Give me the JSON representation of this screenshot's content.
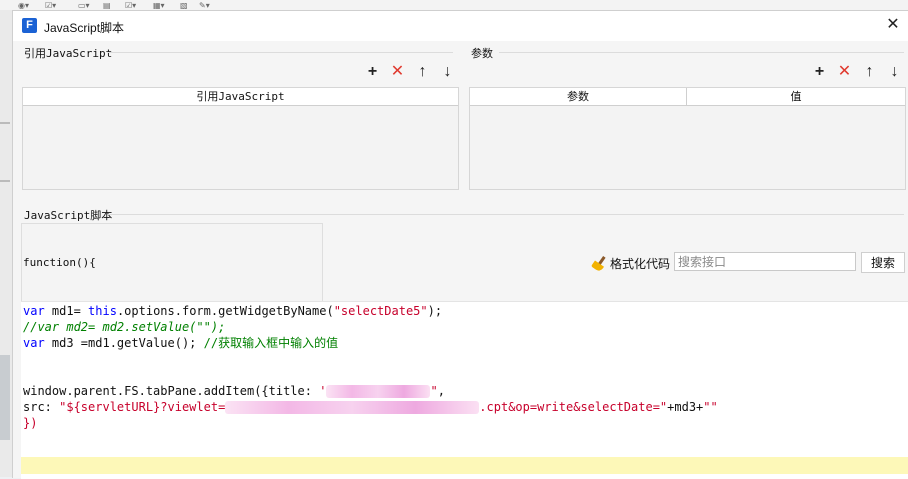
{
  "window": {
    "title": "JavaScript脚本",
    "logo_text": "F"
  },
  "left_panel": {
    "section_label": "引用JavaScript",
    "columns": [
      "引用JavaScript"
    ],
    "toolbar": [
      "plus-icon",
      "delete-icon",
      "arrow-up-icon",
      "arrow-down-icon"
    ]
  },
  "right_panel": {
    "section_label": "参数",
    "columns": [
      "参数",
      "值"
    ],
    "toolbar": [
      "plus-icon",
      "delete-icon",
      "arrow-up-icon",
      "arrow-down-icon"
    ]
  },
  "script_section": {
    "label": "JavaScript脚本",
    "function_header": "function(){",
    "format_label": "格式化代码",
    "search_placeholder": "搜索接口",
    "search_button": "搜索"
  },
  "code": {
    "l1_kw": "var",
    "l1_a": " md1= ",
    "l1_kw2": "this",
    "l1_b": ".options.form.getWidgetByName(",
    "l1_str": "\"selectDate5\"",
    "l1_c": ");",
    "l2": "//var md2= md2.setValue(\"\");",
    "l3_kw": "var",
    "l3_a": " md3 =md1.getValue(); ",
    "l3_cmt": "//获取输入框中输入的值",
    "l5_a": "window.parent.FS.tabPane.addItem({title: ",
    "l5_q1": "'",
    "l5_q2": "\"",
    "l5_b": ",",
    "l6_a": "src: ",
    "l6_str1": "\"${servletURL}?viewlet=",
    "l6_str2": ".cpt&op=write&selectDate=\"",
    "l6_b": "+md3+",
    "l6_str3": "\"\"",
    "l7": "})"
  },
  "colors": {
    "keyword": "#0000ff",
    "string": "#a31515",
    "comment": "#008000",
    "delete": "#e03a2f",
    "highlight": "#fdf8b8"
  }
}
